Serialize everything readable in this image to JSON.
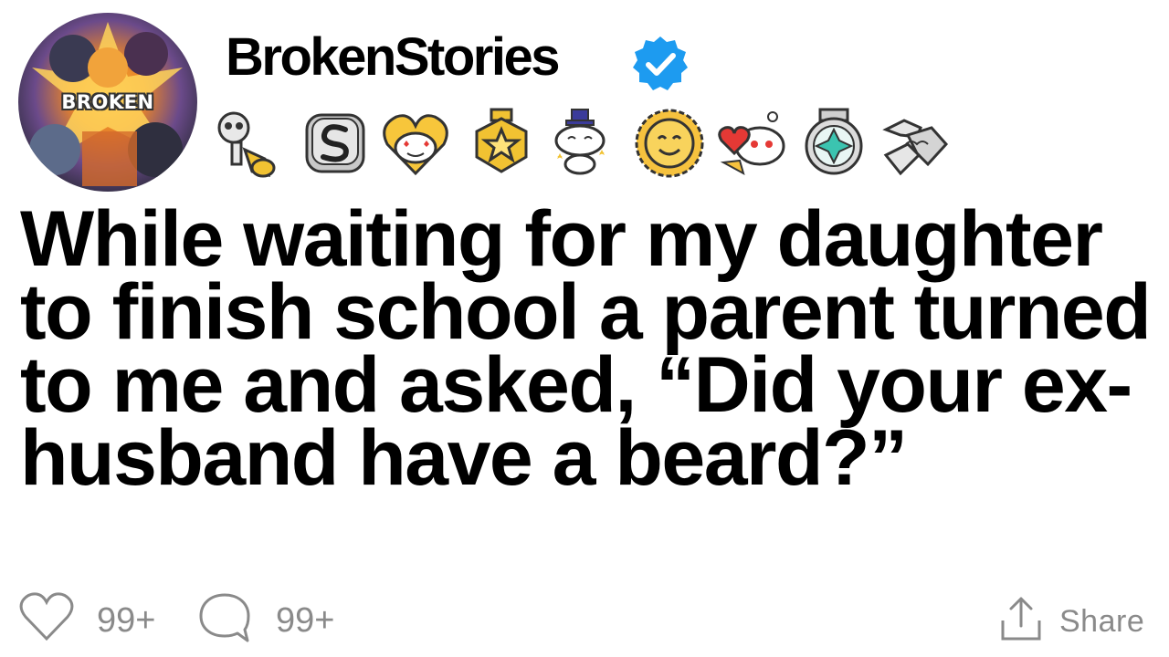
{
  "author": {
    "username": "BrokenStories",
    "avatar_text": "BROKEN",
    "verified": true,
    "verified_color": "#1d9bf0"
  },
  "badges": [
    "skeleton-trumpet-award-icon",
    "silver-s-award-icon",
    "heart-eyes-snoo-award-icon",
    "gold-star-award-icon",
    "wizard-snoo-award-icon",
    "sun-face-award-icon",
    "heart-snoo-award-icon",
    "gem-medal-award-icon",
    "handshake-award-icon"
  ],
  "post": {
    "title": "While waiting for my daughter to finish school a parent turned to me and asked, “Did your ex-husband have a beard?”"
  },
  "actions": {
    "like_count": "99+",
    "comment_count": "99+",
    "share_label": "Share",
    "icon_color": "#8a8a8a"
  }
}
